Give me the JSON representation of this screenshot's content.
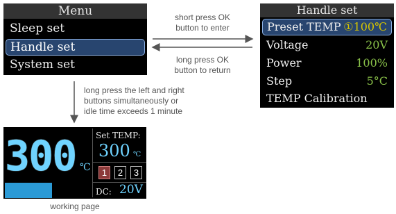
{
  "menu": {
    "title": "Menu",
    "items": [
      {
        "label": "Sleep set"
      },
      {
        "label": "Handle set"
      },
      {
        "label": "System set"
      }
    ]
  },
  "handle_set": {
    "title": "Handle set",
    "rows": [
      {
        "label": "Preset TEMP",
        "value": "①100℃"
      },
      {
        "label": "Voltage",
        "value": "20V"
      },
      {
        "label": "Power",
        "value": "100%"
      },
      {
        "label": "Step",
        "value": "5°C"
      },
      {
        "label": "TEMP Calibration",
        "value": ""
      }
    ]
  },
  "working": {
    "temp": "300",
    "temp_unit": "℃",
    "set_label": "Set TEMP:",
    "set_value": "300",
    "set_unit": "℃",
    "presets": [
      "1",
      "2",
      "3"
    ],
    "active_preset": "1",
    "dc_label": "DC:",
    "dc_value": "20V",
    "power_level": 0.55
  },
  "annotations": {
    "enter_line1": "short press OK",
    "enter_line2": "button to enter",
    "return_line1": "long press OK",
    "return_line2": "button to return",
    "down_line1": "long press the left and right",
    "down_line2": "buttons simultaneously or",
    "down_line3": "idle time exceeds 1 minute",
    "working_caption": "working page"
  },
  "colors": {
    "selection": "#28456f",
    "value_green": "#8bc34a",
    "temp_blue": "#6fd3ff",
    "bar_blue": "#2b9ad6",
    "active_preset": "#8c3a3a"
  }
}
